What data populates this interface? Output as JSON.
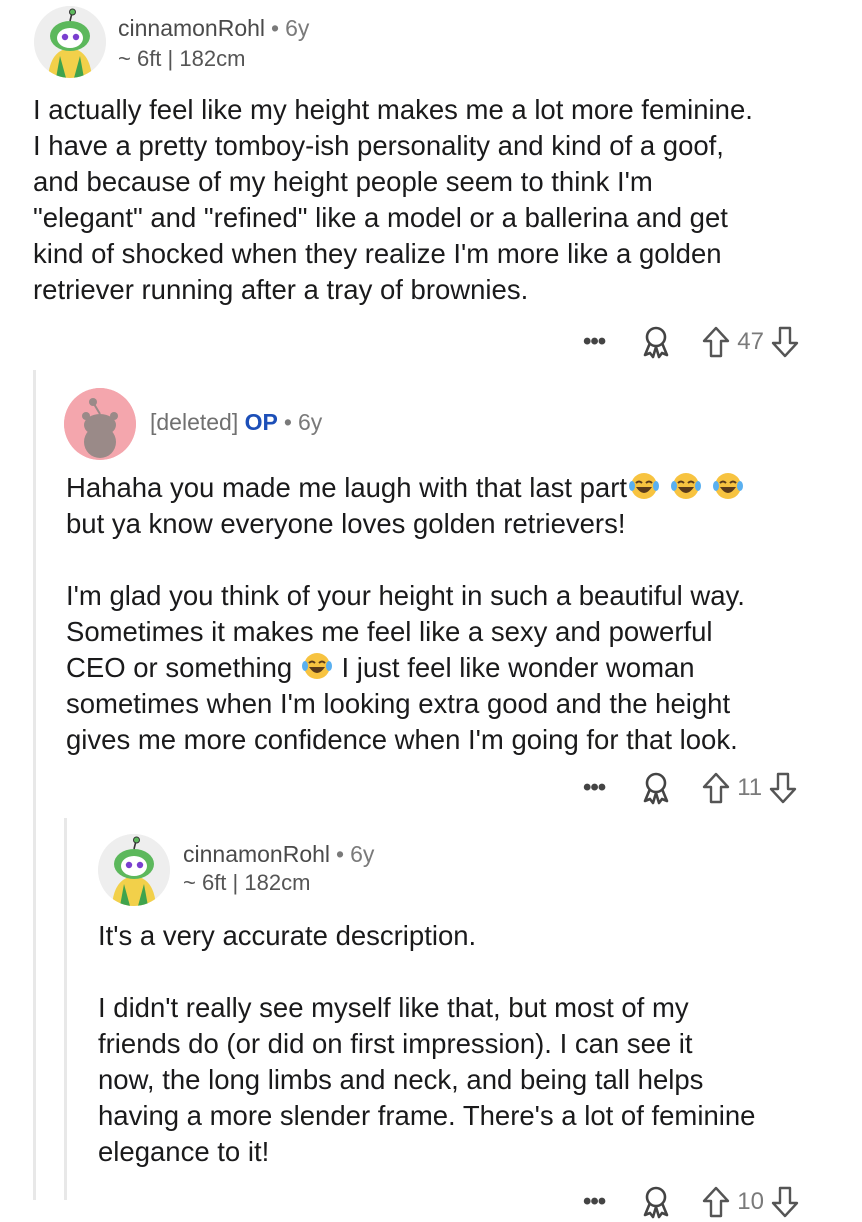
{
  "comments": [
    {
      "author": "cinnamonRohl",
      "separator": "•",
      "age": "6y",
      "flair": "~ 6ft | 182cm",
      "lines": [
        "I actually feel like my height makes me a lot more feminine.",
        "I have a pretty tomboy-ish personality and kind of a goof,",
        "and because of my height people seem to think I'm",
        "\"elegant\" and \"refined\" like a model or a ballerina and get",
        "kind of shocked when they realize I'm more like a golden",
        "retriever running after a tray of brownies."
      ],
      "more": "•••",
      "score": "47"
    },
    {
      "author": "[deleted]",
      "op_tag": "OP",
      "separator": "•",
      "age": "6y",
      "para1": [
        "Hahaha you made me laugh with that last part",
        "but ya know everyone loves golden retrievers!"
      ],
      "para2_line1": "I'm glad you think of your height in such a beautiful way.",
      "para2_line2": "Sometimes it makes me feel like a sexy and powerful",
      "para2_line3a": "CEO or something ",
      "para2_line3b": " I just feel like wonder woman",
      "para2_line4": "sometimes when I'm looking extra good and the height",
      "para2_line5": "gives me more confidence when I'm going for that look.",
      "more": "•••",
      "score": "11"
    },
    {
      "author": "cinnamonRohl",
      "separator": "•",
      "age": "6y",
      "flair": "~ 6ft | 182cm",
      "para1": "It's a very accurate description.",
      "para2": [
        "I didn't really see myself like that, but most of my",
        "friends do (or did on first impression). I can see it",
        "now, the long limbs and neck, and being tall helps",
        "having a more slender frame. There's a lot of feminine",
        "elegance to it!"
      ],
      "more": "•••",
      "score": "10"
    }
  ],
  "icons": {
    "avatar_user": "snoo-avatar-green-hood",
    "avatar_deleted": "snoo-avatar-deleted",
    "award": "award-icon",
    "upvote": "upvote-arrow-icon",
    "downvote": "downvote-arrow-icon",
    "emoji": "laughing-tears-emoji"
  },
  "colors": {
    "op": "#1c4fb8",
    "thread_line": "#e8e8e8",
    "deleted_avatar": "#f4a6ad"
  }
}
